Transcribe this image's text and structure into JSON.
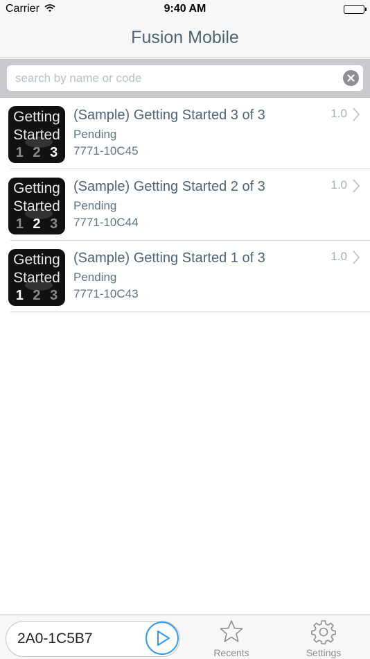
{
  "status_bar": {
    "carrier": "Carrier",
    "time": "9:40 AM",
    "battery_level": 1.0
  },
  "header": {
    "title": "Fusion Mobile"
  },
  "search": {
    "placeholder": "search by name or code",
    "value": ""
  },
  "items": [
    {
      "title": "(Sample) Getting Started 3 of 3",
      "status": "Pending",
      "code": "7771-10C45",
      "version": "1.0",
      "thumb": {
        "line1": "Getting",
        "line2": "Started",
        "n1": "1",
        "n2": "2",
        "n3": "3",
        "highlight": 3
      }
    },
    {
      "title": "(Sample) Getting Started 2 of 3",
      "status": "Pending",
      "code": "7771-10C44",
      "version": "1.0",
      "thumb": {
        "line1": "Getting",
        "line2": "Started",
        "n1": "1",
        "n2": "2",
        "n3": "3",
        "highlight": 2
      }
    },
    {
      "title": "(Sample) Getting Started 1 of 3",
      "status": "Pending",
      "code": "7771-10C43",
      "version": "1.0",
      "thumb": {
        "line1": "Getting",
        "line2": "Started",
        "n1": "1",
        "n2": "2",
        "n3": "3",
        "highlight": 1
      }
    }
  ],
  "bottom_bar": {
    "code_value": "2A0-1C5B7",
    "play_icon": "play-icon",
    "tabs": [
      {
        "label": "Recents",
        "icon": "star-icon"
      },
      {
        "label": "Settings",
        "icon": "gear-icon"
      }
    ]
  },
  "colors": {
    "accent": "#2e9bf0",
    "text": "#4f6474",
    "bar_background": "#f7f7f7",
    "search_background": "#c9c9ce"
  }
}
